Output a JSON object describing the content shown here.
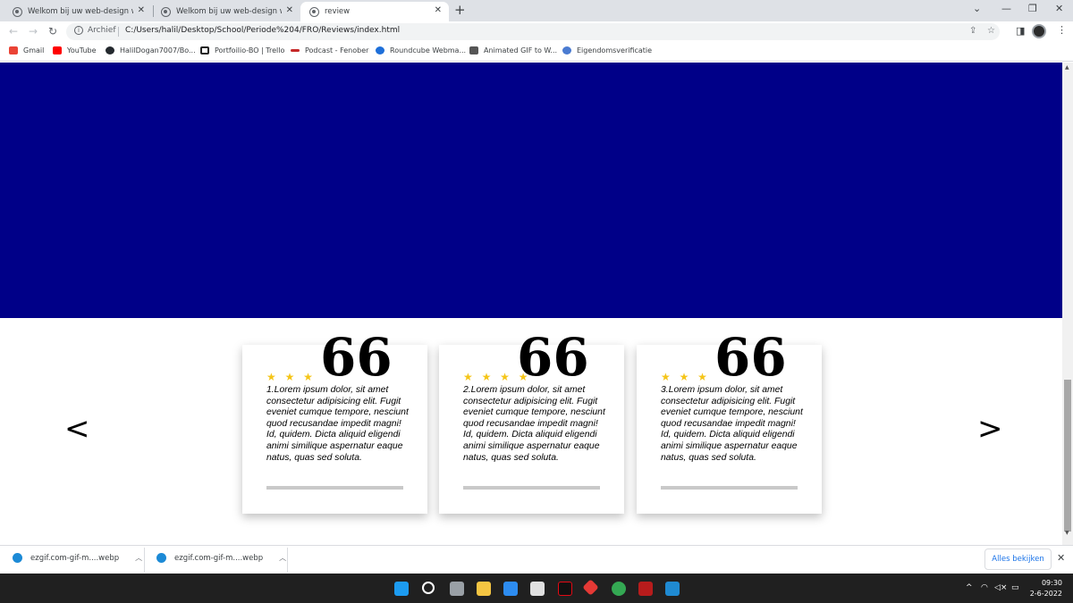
{
  "browser": {
    "tabs": [
      {
        "label": "Welkom bij uw web-design webs",
        "active": false
      },
      {
        "label": "Welkom bij uw web-design webs",
        "active": false
      },
      {
        "label": "review",
        "active": true
      }
    ],
    "new_tab_icon": "plus-icon",
    "address": {
      "security_label": "Archief",
      "url": "C:/Users/halil/Desktop/School/Periode%204/FRO/Reviews/index.html"
    },
    "bookmarks": [
      {
        "label": "Gmail",
        "color": "#ea4335"
      },
      {
        "label": "YouTube",
        "color": "#ff0000"
      },
      {
        "label": "HalilDogan7007/Bo...",
        "color": "#24292e"
      },
      {
        "label": "Portfoilio-BO | Trello",
        "color": "#222222"
      },
      {
        "label": "Podcast - Fenober",
        "color": "#c62828"
      },
      {
        "label": "Roundcube Webma...",
        "color": "#1e6fd9"
      },
      {
        "label": "Animated GIF to W...",
        "color": "#555555"
      },
      {
        "label": "Eigendomsverificatie",
        "color": "#4a7bd1"
      }
    ]
  },
  "page": {
    "hero_color": "#000088",
    "prev_arrow": "<",
    "next_arrow": ">",
    "reviews": [
      {
        "stars": "★ ★ ★",
        "text": "1.Lorem ipsum dolor, sit amet consectetur adipisicing elit. Fugit eveniet cumque tempore, nesciunt quod recusandae impedit magni! Id, quidem. Dicta aliquid eligendi animi similique aspernatur eaque natus, quas sed soluta."
      },
      {
        "stars": "★ ★ ★ ★",
        "text": "2.Lorem ipsum dolor, sit amet consectetur adipisicing elit. Fugit eveniet cumque tempore, nesciunt quod recusandae impedit magni! Id, quidem. Dicta aliquid eligendi animi similique aspernatur eaque natus, quas sed soluta."
      },
      {
        "stars": "★ ★ ★",
        "text": "3.Lorem ipsum dolor, sit amet consectetur adipisicing elit. Fugit eveniet cumque tempore, nesciunt quod recusandae impedit magni! Id, quidem. Dicta aliquid eligendi animi similique aspernatur eaque natus, quas sed soluta."
      }
    ],
    "quote_glyph": "66",
    "star_color": "#f5c518"
  },
  "downloads": {
    "items": [
      {
        "label": "ezgif.com-gif-m....webp"
      },
      {
        "label": "ezgif.com-gif-m....webp"
      }
    ],
    "show_all": "Alles bekijken"
  },
  "taskbar": {
    "time": "09:30",
    "date": "2-6-2022"
  }
}
